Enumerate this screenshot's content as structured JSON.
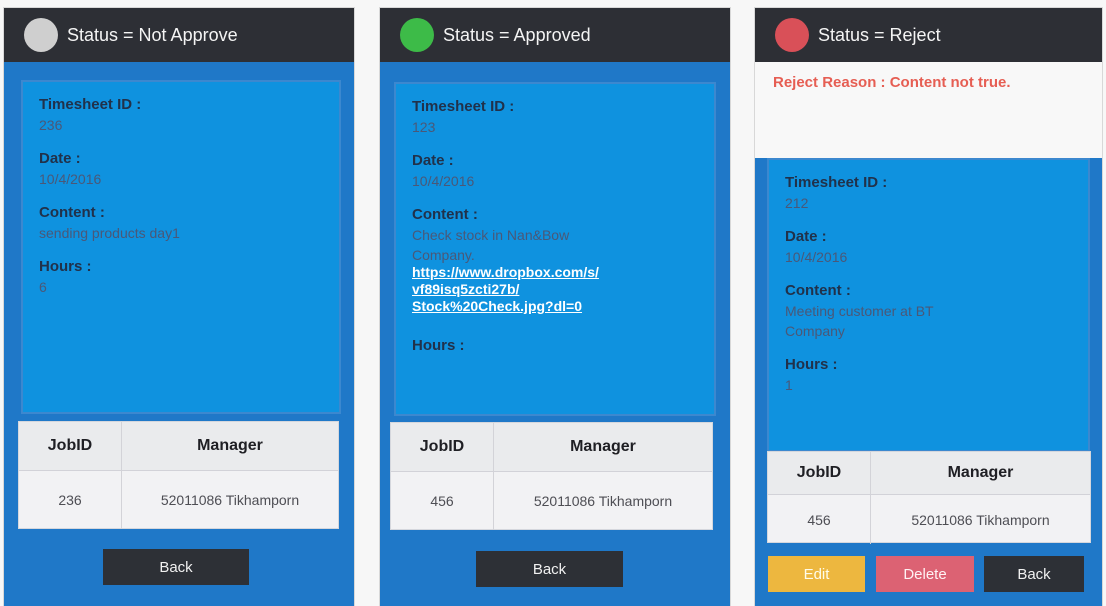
{
  "colors": {
    "status_not_approve": "#cfcfcf",
    "status_approved": "#3dbb48",
    "status_reject": "#d95058",
    "header": "#2d2f35",
    "screen": "#1f78c8",
    "card": "#0f92df",
    "edit": "#edb73f",
    "delete": "#dc6273",
    "back": "#2d3036",
    "reject_text": "#e65e53"
  },
  "icons": {
    "status": "status-dot-icon"
  },
  "screens": [
    {
      "status_text": "Status = Not Approve",
      "timesheet_label": "Timesheet ID :",
      "timesheet_id": "236",
      "date_label": "Date :",
      "date": "10/4/2016",
      "content_label": "Content :",
      "content": "sending products day1",
      "hours_label": "Hours :",
      "hours": "6",
      "table": {
        "headers": [
          "JobID",
          "Manager"
        ],
        "row": [
          "236",
          "52011086  Tikhamporn"
        ]
      },
      "buttons": {
        "back": "Back"
      }
    },
    {
      "status_text": "Status = Approved",
      "timesheet_label": "Timesheet ID :",
      "timesheet_id": "123",
      "date_label": "Date :",
      "date": "10/4/2016",
      "content_label": "Content :",
      "content_lines": [
        "Check stock in Nan&Bow",
        "Company."
      ],
      "link_lines": [
        "https://www.dropbox.com/s/",
        "vf89isq5zcti27b/",
        "Stock%20Check.jpg?dl=0"
      ],
      "hours_label": "Hours :",
      "table": {
        "headers": [
          "JobID",
          "Manager"
        ],
        "row": [
          "456",
          "52011086  Tikhamporn"
        ]
      },
      "buttons": {
        "back": "Back"
      }
    },
    {
      "status_text": "Status = Reject",
      "reject_reason": "Reject Reason : Content not true.",
      "timesheet_label": "Timesheet ID :",
      "timesheet_id": "212",
      "date_label": "Date :",
      "date": "10/4/2016",
      "content_label": "Content :",
      "content_lines": [
        "Meeting customer at BT",
        "Company"
      ],
      "hours_label": "Hours :",
      "hours": "1",
      "table": {
        "headers": [
          "JobID",
          "Manager"
        ],
        "row": [
          "456",
          "52011086  Tikhamporn"
        ]
      },
      "buttons": {
        "edit": "Edit",
        "delete": "Delete",
        "back": "Back"
      }
    }
  ]
}
